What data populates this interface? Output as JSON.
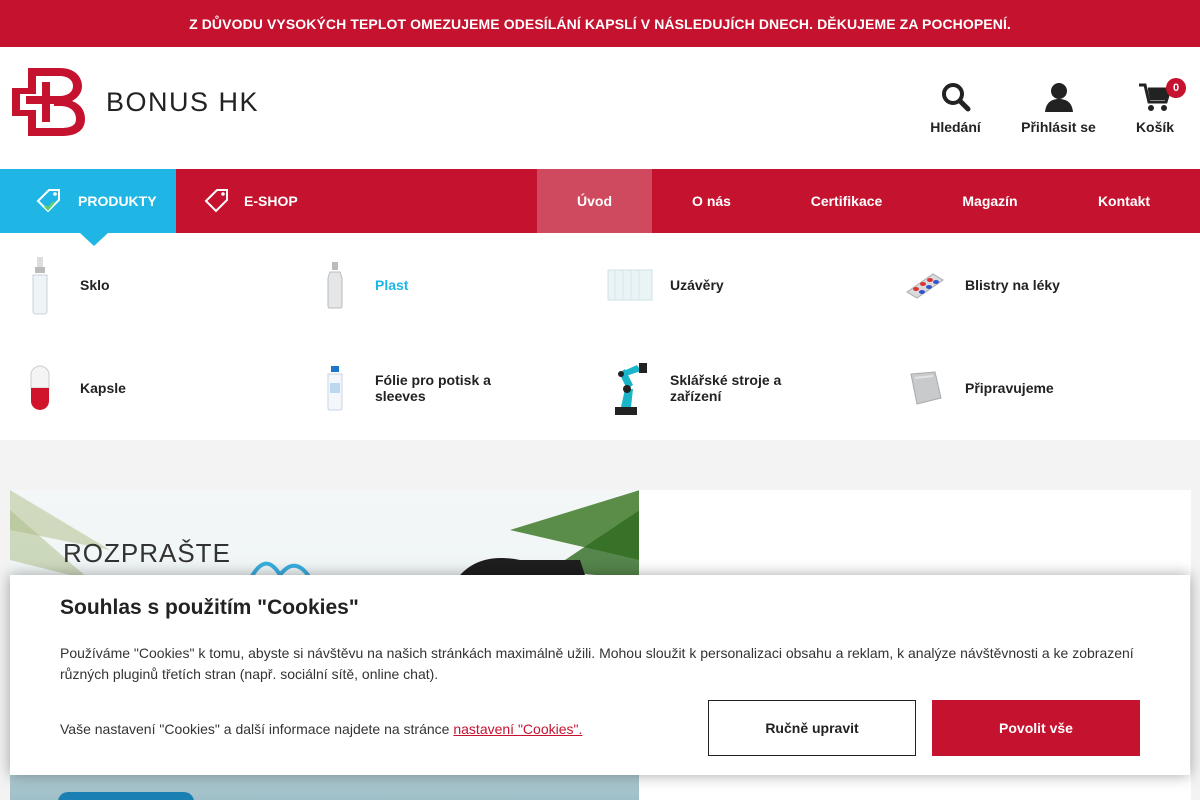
{
  "banner": {
    "text": "Z DŮVODU VYSOKÝCH TEPLOT OMEZUJEME ODESÍLÁNÍ KAPSLÍ V NÁSLEDUJÍCH DNECH.  DĚKUJEME ZA POCHOPENÍ."
  },
  "header": {
    "logo_text": "BONUS HK",
    "search_label": "Hledání",
    "login_label": "Přihlásit se",
    "cart_label": "Košík",
    "cart_count": "0"
  },
  "nav": {
    "products_label": "PRODUKTY",
    "eshop_label": "E-SHOP",
    "links": [
      "Úvod",
      "O nás",
      "Certifikace",
      "Magazín",
      "Kontakt"
    ],
    "active_link": "Úvod"
  },
  "products": [
    {
      "label": "Sklo",
      "icon": "glass-bottle-icon"
    },
    {
      "label": "Plast",
      "icon": "plastic-bottle-icon",
      "highlighted": true
    },
    {
      "label": "Uzávěry",
      "icon": "caps-icon"
    },
    {
      "label": "Blistry na léky",
      "icon": "blister-icon"
    },
    {
      "label": "Kapsle",
      "icon": "capsule-icon"
    },
    {
      "label": "Fólie pro potisk a sleeves",
      "icon": "sleeve-bottle-icon"
    },
    {
      "label": "Sklářské stroje a zařízení",
      "icon": "robot-arm-icon"
    },
    {
      "label": "Připravujeme",
      "icon": "pouch-icon"
    }
  ],
  "hero": {
    "title": "ROZPRAŠTE"
  },
  "cookie": {
    "title": "Souhlas s použitím \"Cookies\"",
    "text": "Používáme \"Cookies\" k tomu, abyste si návštěvu na našich stránkách maximálně užili. Mohou sloužit k personalizaci obsahu a reklam, k analýze návštěvnosti a ke zobrazení různých pluginů třetích stran (např. sociální sítě, online chat).",
    "more_text": "Vaše nastavení \"Cookies\" a další informace najdete na stránce ",
    "more_link": "nastavení \"Cookies\".",
    "manual_button": "Ručně upravit",
    "accept_button": "Povolit vše"
  },
  "colors": {
    "brand_red": "#c4122f",
    "accent_blue": "#1fb6e6",
    "active_nav": "#cf4a5f"
  }
}
